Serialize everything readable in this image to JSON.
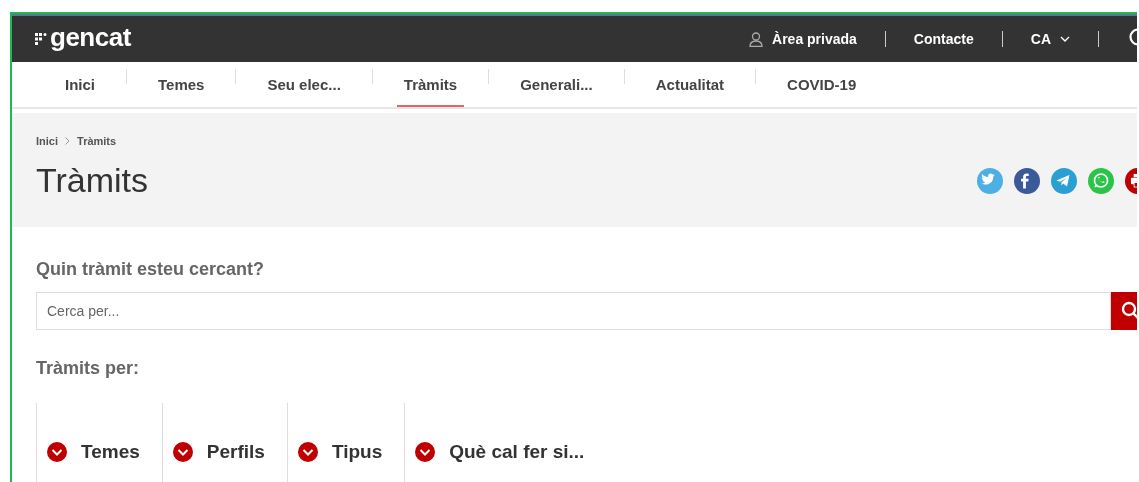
{
  "header": {
    "logo": "gencat",
    "links": [
      {
        "kind": "user",
        "text": "Àrea privada"
      },
      {
        "kind": "plain",
        "text": "Contacte"
      },
      {
        "kind": "dropdown",
        "text": "CA"
      }
    ]
  },
  "nav": [
    {
      "label": "Inici",
      "selected": false
    },
    {
      "label": "Temes",
      "selected": false
    },
    {
      "label": "Seu elec...",
      "selected": false
    },
    {
      "label": "Tràmits",
      "selected": true
    },
    {
      "label": "Generali...",
      "selected": false
    },
    {
      "label": "Actualitat",
      "selected": false
    },
    {
      "label": "COVID-19",
      "selected": false
    }
  ],
  "breadcrumb": [
    "Inici",
    "Tràmits"
  ],
  "title": "Tràmits",
  "search": {
    "label": "Quin tràmit esteu cercant?",
    "placeholder": "Cerca per..."
  },
  "browse": {
    "title": "Tràmits per:",
    "items": [
      "Temes",
      "Perfils",
      "Tipus",
      "Què cal fer si..."
    ]
  }
}
